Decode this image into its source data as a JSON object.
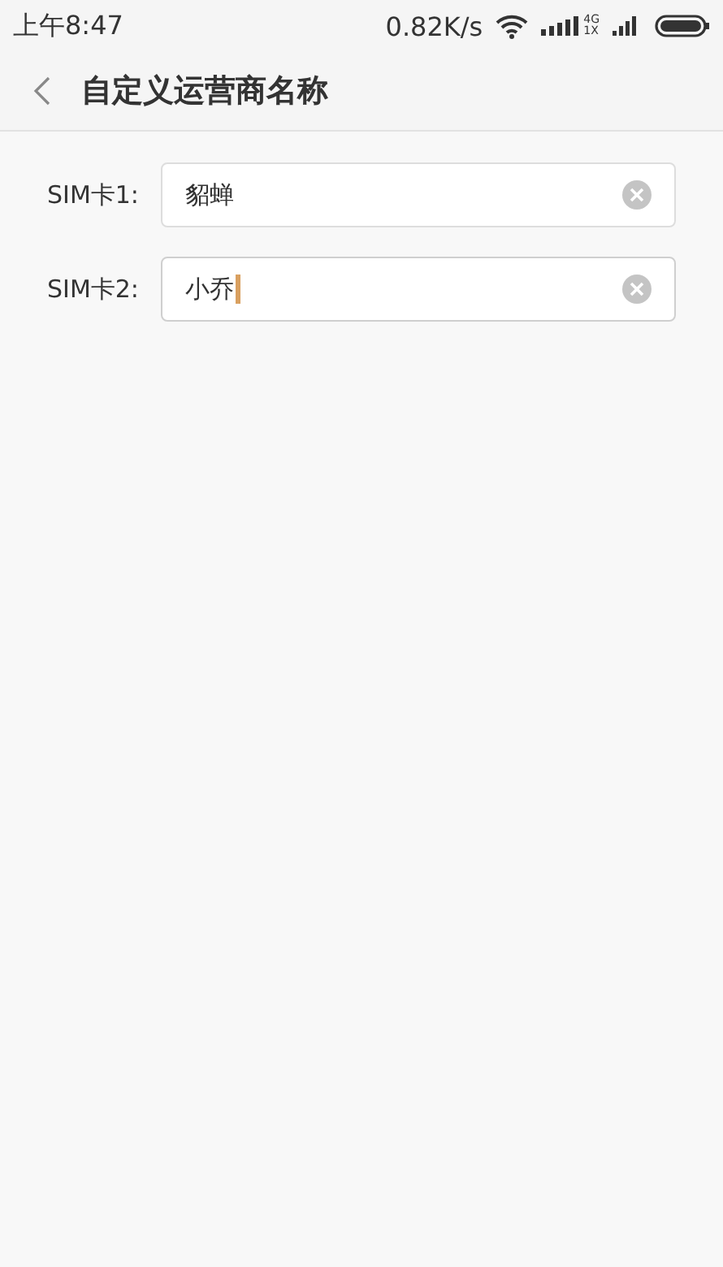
{
  "status_bar": {
    "time": "上午8:47",
    "speed": "0.82K/s",
    "network_top": "4G",
    "network_bottom": "1X"
  },
  "header": {
    "title": "自定义运营商名称"
  },
  "fields": [
    {
      "label": "SIM卡1:",
      "value": "貂蝉",
      "focused": false
    },
    {
      "label": "SIM卡2:",
      "value": "小乔",
      "focused": true
    }
  ]
}
